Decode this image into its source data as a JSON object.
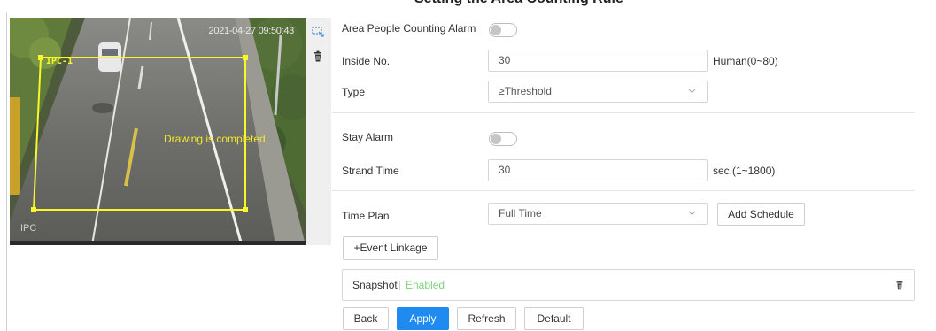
{
  "page": {
    "title": "Setting the Area Counting Rule"
  },
  "video": {
    "timestamp": "2021-04-27 09:50:43",
    "channel_label": "IPC",
    "rule_name": "IPC-1",
    "status_message": "Drawing is completed."
  },
  "tools": {
    "draw_icon": "draw-area-icon",
    "delete_icon": "trash-icon"
  },
  "form": {
    "area_people_counting_alarm": {
      "label": "Area People Counting Alarm",
      "enabled": false
    },
    "inside_no": {
      "label": "Inside No.",
      "value": "30",
      "hint": "Human(0~80)"
    },
    "type": {
      "label": "Type",
      "value": "≥Threshold"
    },
    "stay_alarm": {
      "label": "Stay Alarm",
      "enabled": false
    },
    "strand_time": {
      "label": "Strand Time",
      "value": "30",
      "hint": "sec.(1~1800)"
    },
    "time_plan": {
      "label": "Time Plan",
      "value": "Full Time",
      "add_schedule_label": "Add Schedule"
    },
    "event_linkage_label": "+Event Linkage",
    "snapshot": {
      "label": "Snapshot",
      "status": "Enabled",
      "status_color": "#7ed37e"
    }
  },
  "actions": {
    "back_label": "Back",
    "apply_label": "Apply",
    "refresh_label": "Refresh",
    "default_label": "Default"
  },
  "colors": {
    "primary": "#1f8bf0",
    "rule_line": "#f7f72a",
    "enabled_text": "#7ed37e"
  }
}
